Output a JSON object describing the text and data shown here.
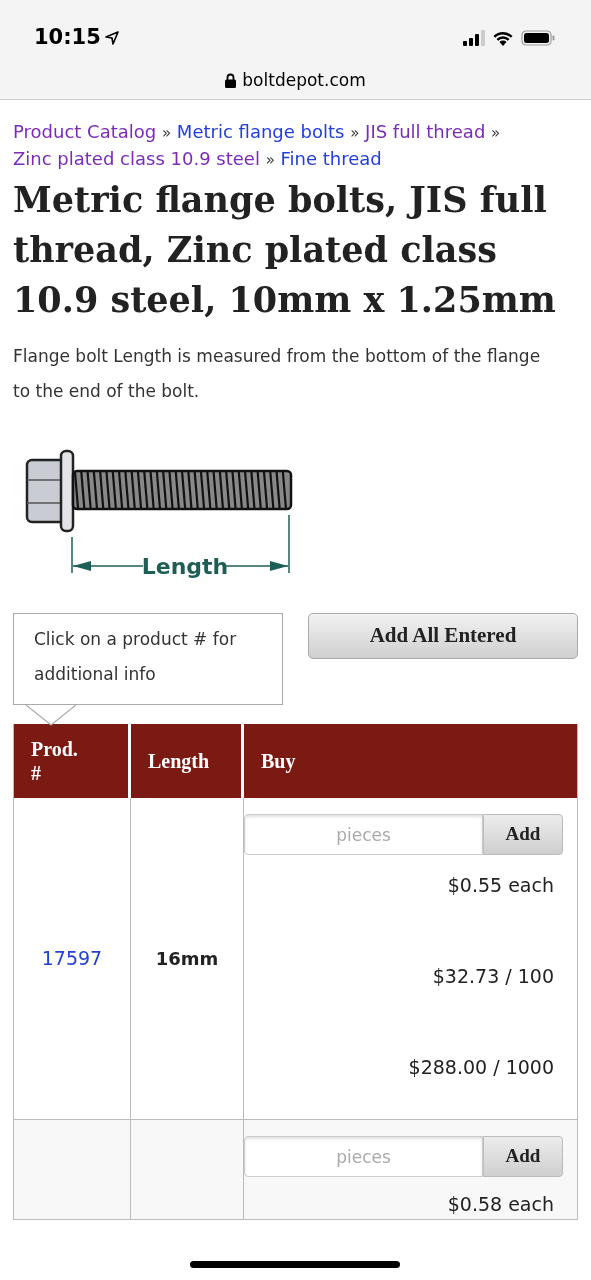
{
  "status_bar": {
    "time": "10:15",
    "url": "boltdepot.com"
  },
  "breadcrumbs": [
    {
      "label": "Product Catalog",
      "visited": true,
      "separator": "»"
    },
    {
      "label": "Metric flange bolts",
      "visited": false,
      "separator": "»"
    },
    {
      "label": "JIS full thread",
      "visited": true,
      "separator": "»"
    },
    {
      "label": "Zinc plated class 10.9 steel",
      "visited": true,
      "separator": "»"
    },
    {
      "label": "Fine thread",
      "visited": false
    }
  ],
  "title": "Metric flange bolts, JIS full thread, Zinc plated class 10.9 steel, 10mm x 1.25mm",
  "description": "Flange bolt Length is measured from the bottom of the flange to the end of the bolt.",
  "diagram": {
    "label": "Length"
  },
  "tip": "Click on a product # for additional info",
  "add_all_button": "Add All Entered",
  "table": {
    "columns": [
      "Prod. #",
      "Length",
      "Buy"
    ],
    "rows": [
      {
        "product": "17597",
        "length": "16mm",
        "placeholder": "pieces",
        "button": "Add",
        "prices": [
          "$0.55 each",
          "$32.73 / 100",
          "$288.00 / 1000"
        ]
      },
      {
        "placeholder": "pieces",
        "button": "Add",
        "prices": [
          "$0.58 each"
        ]
      }
    ]
  }
}
